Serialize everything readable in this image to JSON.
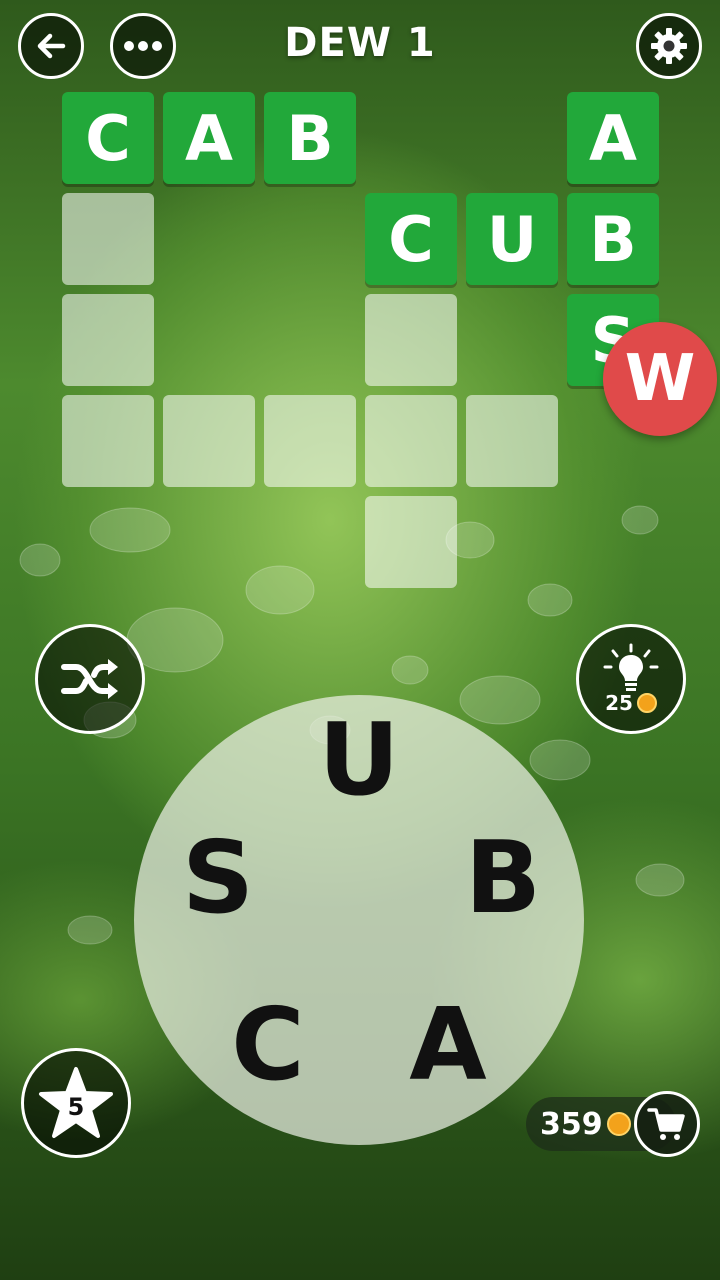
{
  "header": {
    "title": "DEW 1",
    "back_icon": "back-arrow-icon",
    "menu_icon": "more-dots-icon",
    "settings_icon": "gear-icon"
  },
  "grid": {
    "filled_color": "#22a83a",
    "words": [
      "CAB",
      "CUB",
      "ABS"
    ],
    "cells": [
      {
        "letter": "C",
        "state": "filled"
      },
      {
        "letter": "A",
        "state": "filled"
      },
      {
        "letter": "B",
        "state": "filled"
      },
      {
        "letter": "A",
        "state": "filled"
      },
      {
        "letter": "C",
        "state": "filled"
      },
      {
        "letter": "U",
        "state": "filled"
      },
      {
        "letter": "B",
        "state": "filled"
      },
      {
        "letter": "S",
        "state": "filled"
      }
    ]
  },
  "badge": {
    "letter": "W",
    "color": "#e04a4a"
  },
  "wheel_letters": [
    "U",
    "S",
    "B",
    "C",
    "A"
  ],
  "controls": {
    "shuffle_icon": "shuffle-icon",
    "hint_icon": "lightbulb-icon",
    "hint_cost": "25",
    "star_icon": "star-icon",
    "star_count": "5",
    "coins": "359",
    "cart_icon": "cart-icon"
  }
}
